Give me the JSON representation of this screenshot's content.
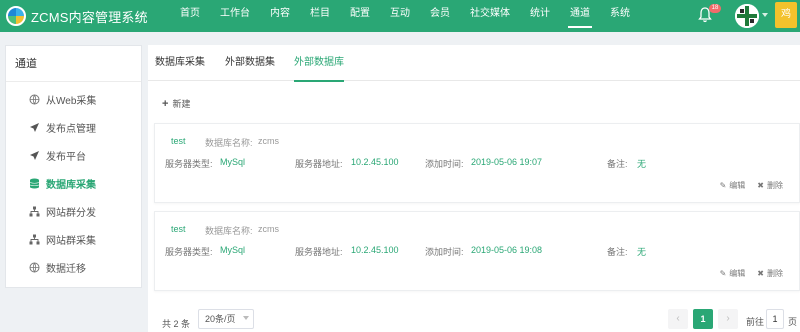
{
  "app": {
    "title": "ZCMS内容管理系统",
    "avatar_initial": "鸡"
  },
  "nav": [
    "首页",
    "工作台",
    "内容",
    "栏目",
    "配置",
    "互动",
    "会员",
    "社交媒体",
    "统计",
    "通道",
    "系统"
  ],
  "notification_count": "18",
  "sidebar": {
    "title": "通道",
    "items": [
      {
        "label": "从Web采集",
        "icon": "globe-icon"
      },
      {
        "label": "发布点管理",
        "icon": "send-icon"
      },
      {
        "label": "发布平台",
        "icon": "send-icon"
      },
      {
        "label": "数据库采集",
        "icon": "database-icon"
      },
      {
        "label": "网站群分发",
        "icon": "sitemap-icon"
      },
      {
        "label": "网站群采集",
        "icon": "sitemap-icon"
      },
      {
        "label": "数据迁移",
        "icon": "globe-icon"
      }
    ]
  },
  "tabs": [
    "数据库采集",
    "外部数据集",
    "外部数据库"
  ],
  "toolbar": {
    "new_label": "新建"
  },
  "labels": {
    "db_name": "数据库名称:",
    "server_type": "服务器类型:",
    "server_addr": "服务器地址:",
    "added_time": "添加时间:",
    "remark": "备注:",
    "edit": "编辑",
    "delete": "删除"
  },
  "records": [
    {
      "name": "test",
      "db_name": "zcms",
      "server_type": "MySql",
      "server_addr": "10.2.45.100",
      "added_time": "2019-05-06 19:07",
      "remark": "无"
    },
    {
      "name": "test",
      "db_name": "zcms",
      "server_type": "MySql",
      "server_addr": "10.2.45.100",
      "added_time": "2019-05-06 19:08",
      "remark": "无"
    }
  ],
  "pagination": {
    "total": "共 2 条",
    "page_size": "20条/页",
    "current": "1",
    "goto_prefix": "前往",
    "goto_value": "1",
    "goto_suffix": "页"
  },
  "colors": {
    "brand": "#2aa775",
    "badge": "#f26b6b",
    "corner": "#f3c22c"
  }
}
